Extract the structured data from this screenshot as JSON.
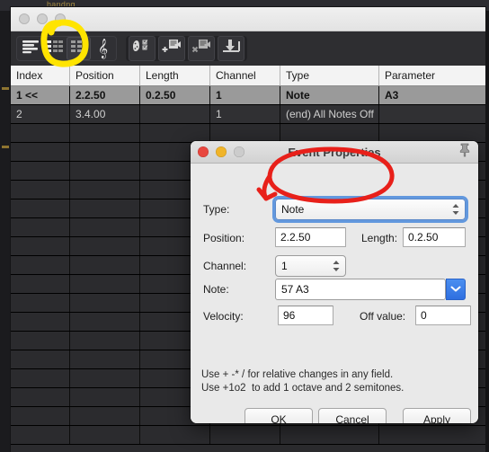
{
  "background_app": {
    "title": "handng"
  },
  "window": {
    "traffic_lights": [
      "close-disabled",
      "minimize-disabled",
      "zoom-disabled"
    ],
    "toolbar": {
      "groups": [
        {
          "name": "view-modes",
          "buttons": [
            {
              "name": "piano-roll-view-button",
              "icon": "piano-roll-icon",
              "active": false
            },
            {
              "name": "percussion-matrix-view-button",
              "icon": "matrix-icon",
              "active": false
            },
            {
              "name": "event-list-view-button",
              "icon": "grid-table-icon",
              "active": true
            },
            {
              "name": "notation-view-button",
              "icon": "treble-clef-icon",
              "active": false
            }
          ]
        },
        {
          "name": "event-tools",
          "buttons": [
            {
              "name": "event-filter-button",
              "icon": "palette-checklist-icon",
              "active": false
            },
            {
              "name": "insert-event-button",
              "icon": "event-plus-icon",
              "active": false
            },
            {
              "name": "delete-event-button",
              "icon": "event-delete-icon",
              "active": false
            },
            {
              "name": "collapse-events-button",
              "icon": "down-arrow-box-icon",
              "active": false
            }
          ]
        }
      ]
    },
    "table": {
      "columns": [
        "Index",
        "Position",
        "Length",
        "Channel",
        "Type",
        "Parameter"
      ],
      "rows": [
        {
          "index": "1 <<",
          "position": "2.2.50",
          "length": "0.2.50",
          "channel": "1",
          "type": "Note",
          "parameter": "A3",
          "selected": true
        },
        {
          "index": "2",
          "position": "3.4.00",
          "length": "",
          "channel": "1",
          "type": "(end) All Notes Off",
          "parameter": "",
          "selected": false
        }
      ],
      "empty_row_count": 17
    }
  },
  "dialog": {
    "title": "Event Properties",
    "traffic_lights": [
      "close",
      "minimize",
      "zoom-disabled"
    ],
    "pin_icon": "pushpin-icon",
    "fields": {
      "type_label": "Type:",
      "type_value": "Note",
      "position_label": "Position:",
      "position_value": "2.2.50",
      "length_label": "Length:",
      "length_value": "0.2.50",
      "channel_label": "Channel:",
      "channel_value": "1",
      "note_label": "Note:",
      "note_value": "57 A3",
      "velocity_label": "Velocity:",
      "velocity_value": "96",
      "off_value_label": "Off value:",
      "off_value_value": "0"
    },
    "help_line1": "Use + -* / for relative changes in any field.",
    "help_line2": "Use +1o2  to add 1 octave and 2 semitones.",
    "buttons": {
      "ok": "OK",
      "cancel": "Cancel",
      "apply": "Apply"
    }
  },
  "annotations": [
    {
      "name": "yellow-highlight-event-list-button",
      "color": "#ffe400",
      "shape": "ellipse"
    },
    {
      "name": "red-highlight-type-field",
      "color": "#e8201a",
      "shape": "ellipse-with-arrow"
    }
  ],
  "colors": {
    "annotation_yellow": "#ffe400",
    "annotation_red": "#e8201a",
    "selection_gray": "#9a9a9a",
    "dialog_bg": "#e9e9e9",
    "focus_blue": "#4a89dc",
    "dropdown_blue": "#2f6fe0"
  }
}
